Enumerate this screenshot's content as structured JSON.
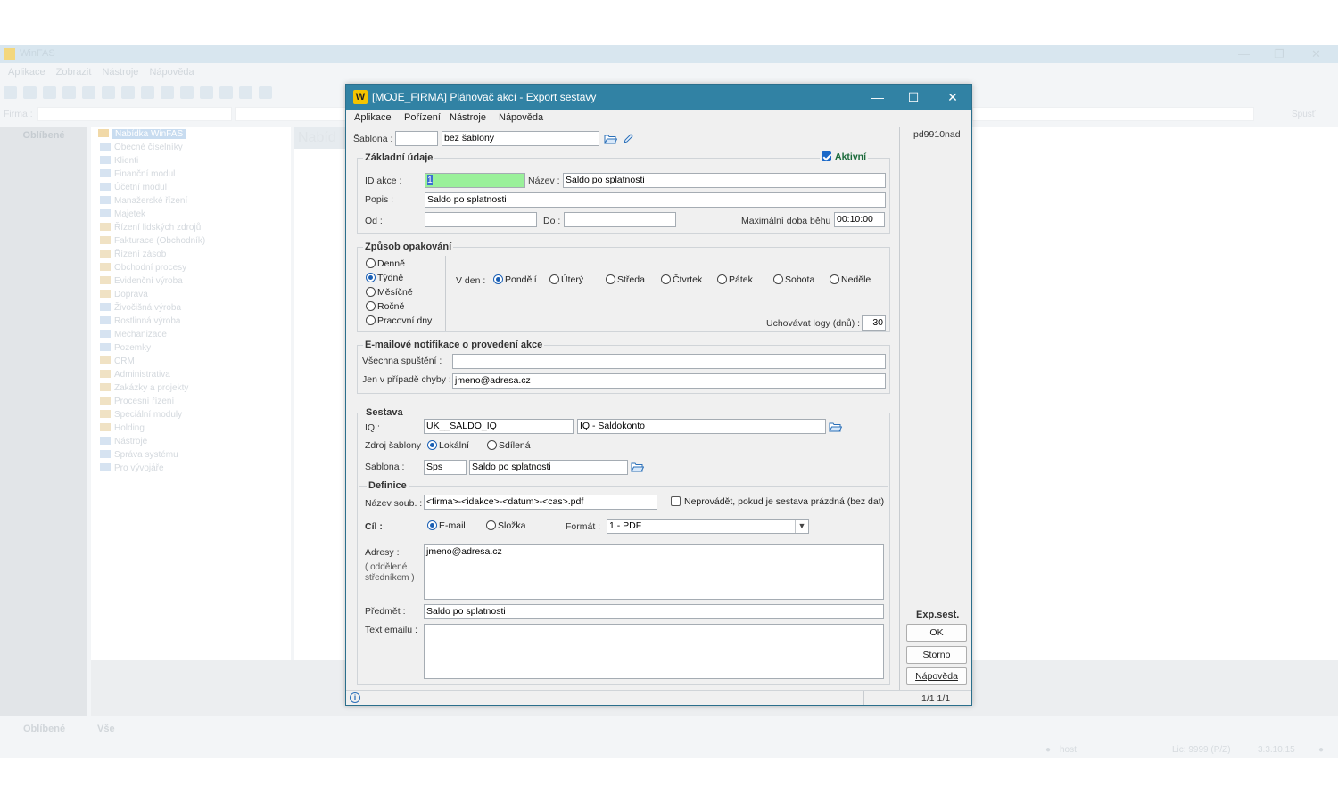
{
  "bg": {
    "title": "WinFAS",
    "menu": [
      "Aplikace",
      "Zobrazit",
      "Nástroje",
      "Nápověda"
    ],
    "firma_label": "Firma :",
    "spust": "Spusť",
    "left_tab": "Oblíbené",
    "tree_root": "Nabídka WinFAS",
    "tree_items": [
      "Obecné číselníky",
      "Klienti",
      "Finanční modul",
      "Účetní modul",
      "Manažerské řízení",
      "Majetek",
      "Řízení lidských zdrojů",
      "Fakturace (Obchodník)",
      "Řízení zásob",
      "Obchodní procesy",
      "Evidenční výroba",
      "Doprava",
      "Živočišná výroba",
      "Rostlinná výroba",
      "Mechanizace",
      "Pozemky",
      "CRM",
      "Administrativa",
      "Zakázky a projekty",
      "Procesní řízení",
      "Speciální moduly",
      "Holding",
      "Nástroje",
      "Správa systému",
      "Pro vývojáře"
    ],
    "center_header": "Nabíd",
    "bottom_tabs": [
      "Oblíbené",
      "Vše"
    ],
    "status_user": "host",
    "status_lic": "Lic: 9999 (P/Z)",
    "status_ver": "3.3.10.15"
  },
  "dialog": {
    "title": "[MOJE_FIRMA] Plánovač akcí - Export sestavy",
    "logo": "W",
    "menu": [
      "Aplikace",
      "Pořízení",
      "Nástroje",
      "Nápověda"
    ],
    "user_code": "pd9910nad",
    "sablona_label": "Šablona :",
    "sablona_code": "",
    "sablona_name": "bez šablony",
    "zakladni": {
      "title": "Základní údaje",
      "aktivni_label": "Aktivní",
      "id_label": "ID akce :",
      "id_value": "1",
      "nazev_label": "Název :",
      "nazev_value": "Saldo po splatnosti",
      "popis_label": "Popis :",
      "popis_value": "Saldo po splatnosti",
      "od_label": "Od :",
      "od_value": "",
      "do_label": "Do :",
      "do_value": "",
      "maxdoba_label": "Maximální doba běhu :",
      "maxdoba_value": "00:10:00"
    },
    "opakovani": {
      "title": "Způsob opakování",
      "modes": [
        "Denně",
        "Týdně",
        "Měsíčně",
        "Ročně",
        "Pracovní dny"
      ],
      "vden_label": "V den :",
      "days": [
        "Pondělí",
        "Úterý",
        "Středa",
        "Čtvrtek",
        "Pátek",
        "Sobota",
        "Neděle"
      ],
      "logy_label": "Uchovávat logy (dnů) :",
      "logy_value": "30"
    },
    "email": {
      "title": "E-mailové notifikace o provedení akce",
      "vsechna_label": "Všechna spuštění :",
      "vsechna_value": "",
      "chyba_label": "Jen v případě chyby :",
      "chyba_value": "jmeno@adresa.cz"
    },
    "sestava": {
      "title": "Sestava",
      "iq_label": "IQ :",
      "iq_code": "UK__SALDO_IQ",
      "iq_name": "IQ - Saldokonto",
      "zdroj_label": "Zdroj šablony :",
      "zdroj_options": [
        "Lokální",
        "Sdílená"
      ],
      "sablona_label": "Šablona :",
      "sablona_code": "Sps",
      "sablona_name": "Saldo po splatnosti"
    },
    "definice": {
      "title": "Definice",
      "soub_label": "Název soub. :",
      "soub_value": "<firma>-<idakce>-<datum>-<cas>.pdf",
      "neprovadet_label": "Neprovádět, pokud je sestava prázdná (bez dat)",
      "cil_label": "Cíl :",
      "cil_options": [
        "E-mail",
        "Složka"
      ],
      "format_label": "Formát :",
      "format_value": "1 - PDF",
      "adresy_label": "Adresy :",
      "adresy_hint1": "( oddělené",
      "adresy_hint2": "středníkem )",
      "adresy_value": "jmeno@adresa.cz",
      "predmet_label": "Předmět :",
      "predmet_value": "Saldo po splatnosti",
      "text_label": "Text emailu :",
      "text_value": ""
    },
    "side": {
      "heading": "Exp.sest.",
      "ok": "OK",
      "storno": "Storno",
      "napoveda": "Nápověda"
    },
    "status": {
      "paging": "1/1  1/1"
    }
  }
}
